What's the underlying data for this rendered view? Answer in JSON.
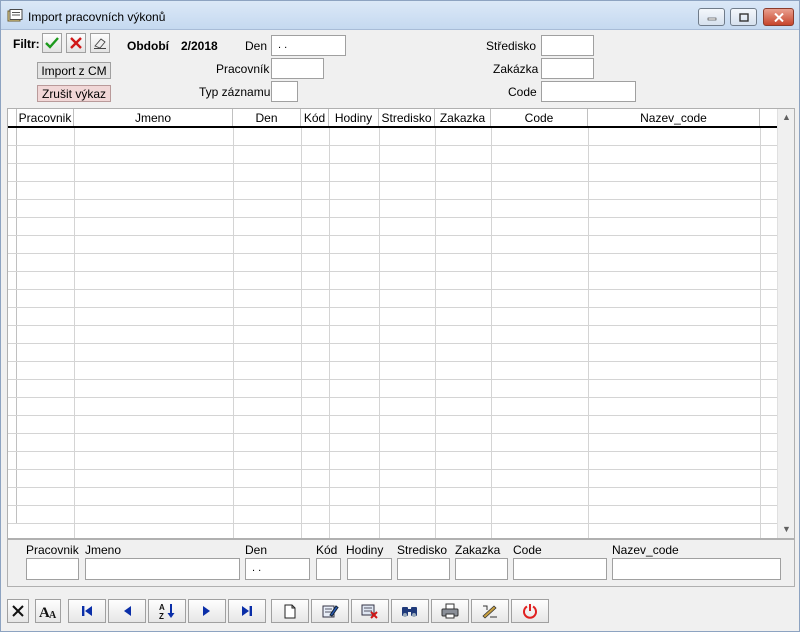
{
  "window": {
    "title": "Import pracovních výkonů"
  },
  "filter": {
    "label": "Filtr:",
    "apply_icon": "check-icon",
    "clear_icon": "x-icon",
    "eraser_icon": "eraser-icon"
  },
  "buttons": {
    "import_label": "Import z CM",
    "cancel_label": "Zrušit výkaz"
  },
  "period": {
    "label": "Období",
    "value": "2/2018"
  },
  "fields": {
    "den_label": "Den",
    "den_value": " .  .",
    "pracovnik_label": "Pracovník",
    "pracovnik_value": "",
    "typ_label": "Typ záznamu",
    "typ_value": "",
    "stredisko_label": "Středisko",
    "stredisko_value": "",
    "zakazka_label": "Zakázka",
    "zakazka_value": "",
    "code_label": "Code",
    "code_value": ""
  },
  "grid": {
    "columns": [
      "Pracovnik",
      "Jmeno",
      "Den",
      "Kód",
      "Hodiny",
      "Stredisko",
      "Zakazka",
      "Code",
      "Nazev_code"
    ],
    "rows": []
  },
  "detail": {
    "pracovnik_label": "Pracovnik",
    "jmeno_label": "Jmeno",
    "den_label": "Den",
    "den_value": " .  .",
    "kod_label": "Kód",
    "hodiny_label": "Hodiny",
    "stredisko_label": "Stredisko",
    "zakazka_label": "Zakazka",
    "code_label": "Code",
    "nazev_label": "Nazev_code"
  },
  "toolbar_icons": [
    "close-icon",
    "font-icon",
    "first-record-icon",
    "previous-record-icon",
    "sort-icon",
    "next-record-icon",
    "last-record-icon",
    "new-record-icon",
    "edit-icon",
    "delete-icon",
    "search-icon",
    "print-icon",
    "settings-icon",
    "power-icon"
  ],
  "colors": {
    "accent_green": "#1c9a1c",
    "accent_red": "#d01818",
    "power_red": "#e02020"
  }
}
